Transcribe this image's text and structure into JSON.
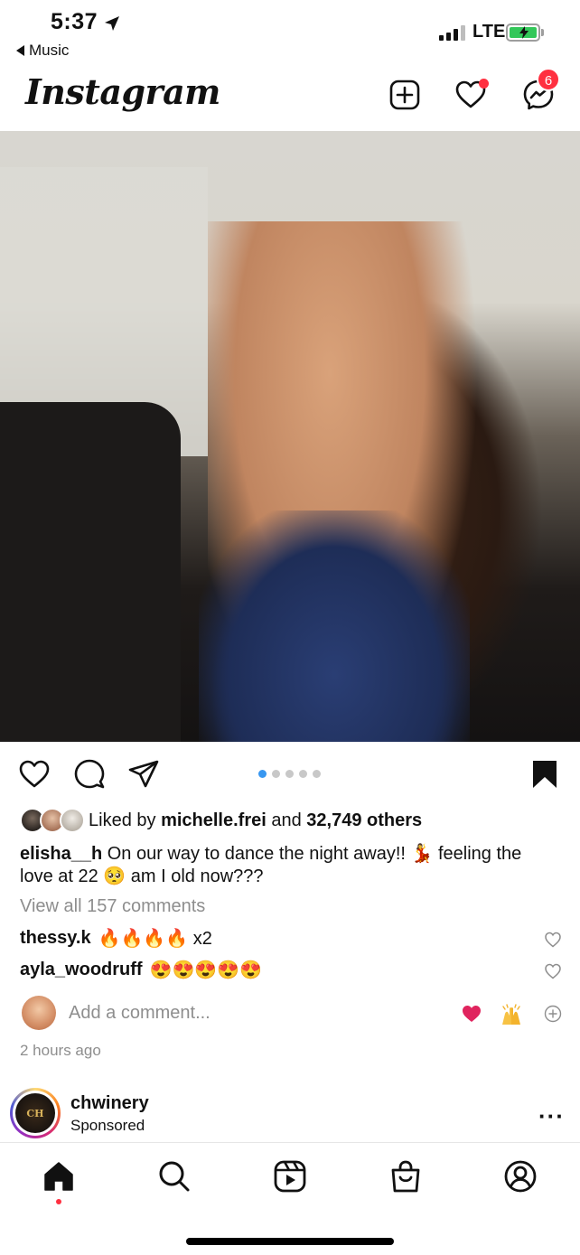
{
  "status_bar": {
    "time": "5:37",
    "back_app": "Music",
    "network": "LTE"
  },
  "header": {
    "logo": "Instagram",
    "messages_badge": "6"
  },
  "post": {
    "carousel": {
      "count": 5,
      "active_index": 0
    },
    "likes": {
      "prefix": "Liked by",
      "user": "michelle.frei",
      "joiner": "and",
      "others": "32,749 others"
    },
    "caption": {
      "user": "elisha__h",
      "text": "On our way to dance the night away!! 💃 feeling the love at 22 🥺 am I old now???"
    },
    "view_all_comments": "View all 157 comments",
    "comments": [
      {
        "user": "thessy.k",
        "text": "🔥🔥🔥🔥 x2"
      },
      {
        "user": "ayla_woodruff",
        "text": "😍😍😍😍😍"
      }
    ],
    "add_comment_placeholder": "Add a comment...",
    "time_ago": "2 hours ago"
  },
  "next_post": {
    "user": "chwinery",
    "subtitle": "Sponsored",
    "logo_text": "CH"
  },
  "colors": {
    "badge_red": "#ff3040",
    "link_blue": "#3897f0",
    "muted_gray": "#8e8e8e",
    "battery_green": "#32c759"
  },
  "icons": {
    "header": [
      "new-post-icon",
      "heart-icon",
      "messenger-icon"
    ],
    "post_actions": [
      "like-icon",
      "comment-icon",
      "share-icon",
      "save-icon"
    ],
    "tabs": [
      "home-icon",
      "search-icon",
      "reels-icon",
      "shop-icon",
      "profile-icon"
    ]
  }
}
